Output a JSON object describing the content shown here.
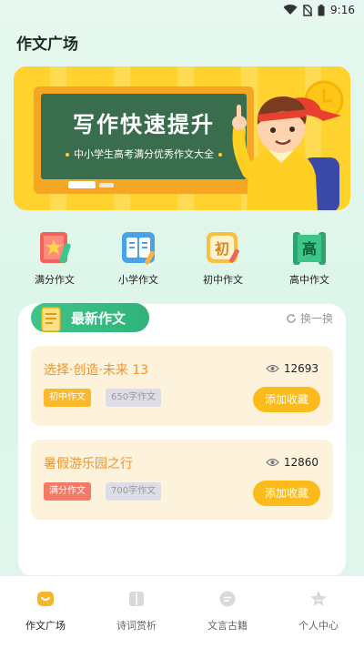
{
  "status_bar": {
    "time": "9:16"
  },
  "header": {
    "title": "作文广场"
  },
  "banner": {
    "title": "写作快速提升",
    "subtitle": "中小学生高考满分优秀作文大全"
  },
  "categories": [
    {
      "label": "满分作文",
      "icon": "star-book-icon",
      "color": "#f0635a"
    },
    {
      "label": "小学作文",
      "icon": "open-book-icon",
      "color": "#4aa3e8"
    },
    {
      "label": "初中作文",
      "icon": "chu-character-icon",
      "glyph": "初",
      "color": "#f7c043"
    },
    {
      "label": "高中作文",
      "icon": "gao-scroll-icon",
      "glyph": "高",
      "color": "#3ec58a"
    }
  ],
  "latest": {
    "title": "最新作文",
    "refresh_label": "换一换",
    "items": [
      {
        "title": "选择·创造·未来 13",
        "views": "12693",
        "tag1": "初中作文",
        "tag2": "650字作文",
        "button": "添加收藏"
      },
      {
        "title": "暑假游乐园之行",
        "views": "12860",
        "tag1": "满分作文",
        "tag2": "700字作文",
        "button": "添加收藏"
      }
    ]
  },
  "bottom_nav": [
    {
      "label": "作文广场",
      "icon": "square-home-icon",
      "active": true
    },
    {
      "label": "诗词赏析",
      "icon": "poetry-book-icon",
      "active": false
    },
    {
      "label": "文言古籍",
      "icon": "classics-chat-icon",
      "active": false
    },
    {
      "label": "个人中心",
      "icon": "profile-star-icon",
      "active": false
    }
  ],
  "colors": {
    "accent_green": "#3ec58a",
    "accent_yellow": "#fbbb1a",
    "title_orange": "#f0932c",
    "banner_yellow": "#ffd22e"
  }
}
